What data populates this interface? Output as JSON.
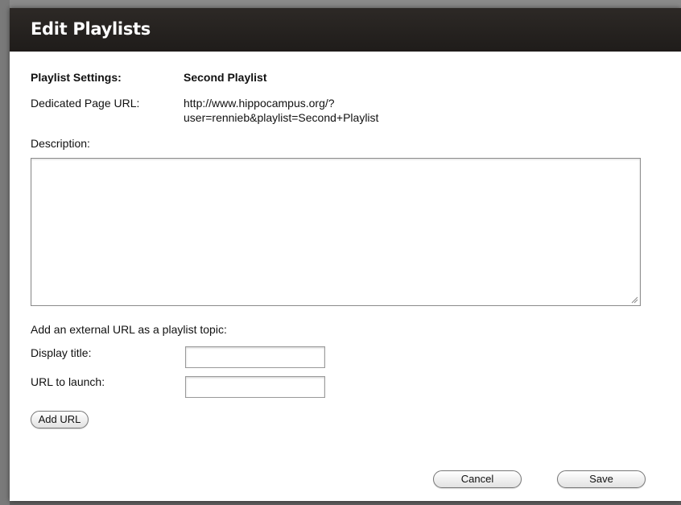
{
  "dialog": {
    "title": "Edit Playlists",
    "settings_label": "Playlist Settings:",
    "playlist_name": "Second Playlist",
    "url_label": "Dedicated Page URL:",
    "url_line1": "http://www.hippocampus.org/?",
    "url_line2": "user=rennieb&playlist=Second+Playlist",
    "description_label": "Description:",
    "description_value": "",
    "external_heading": "Add an external URL as a playlist topic:",
    "display_title_label": "Display title:",
    "display_title_value": "",
    "url_launch_label": "URL to launch:",
    "url_launch_value": "",
    "add_url_button": "Add URL",
    "cancel_button": "Cancel",
    "save_button": "Save"
  },
  "colors": {
    "titlebar": "#2d2926",
    "title_text": "#ffffff",
    "backdrop": "#5e5e5e"
  }
}
